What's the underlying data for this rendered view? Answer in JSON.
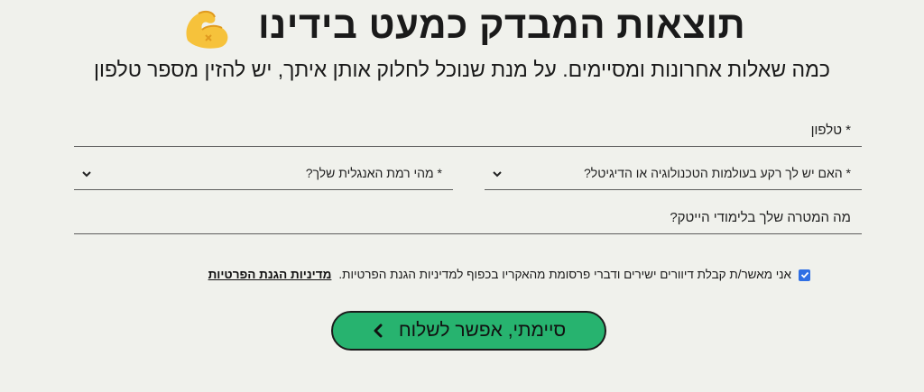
{
  "header": {
    "title": "תוצאות המבדק כמעט בידינו",
    "title_icon": "flexed-biceps-icon",
    "subtitle": "כמה שאלות אחרונות ומסיימים. על מנת שנוכל לחלוק אותן איתך, יש להזין מספר טלפון"
  },
  "form": {
    "phone_label": "* טלפון",
    "tech_background_label": "* האם יש לך רקע בעולמות הטכנולוגיה או הדיגיטל?",
    "english_level_label": "* מהי רמת האנגלית שלך?",
    "goal_label": "מה המטרה שלך בלימודי הייטק?",
    "consent_text": "אני מאשר/ת קבלת דיוורים ישירים ודברי פרסומת מהאקריו בכפוף למדיניות הגנת הפרטיות.",
    "privacy_link": "מדיניות הגנת הפרטיות",
    "consent_checked": true,
    "submit_label": "סיימתי, אפשר לשלוח"
  },
  "colors": {
    "background": "#f0f1ec",
    "button": "#27b36f",
    "checkbox": "#2f6fe4"
  }
}
